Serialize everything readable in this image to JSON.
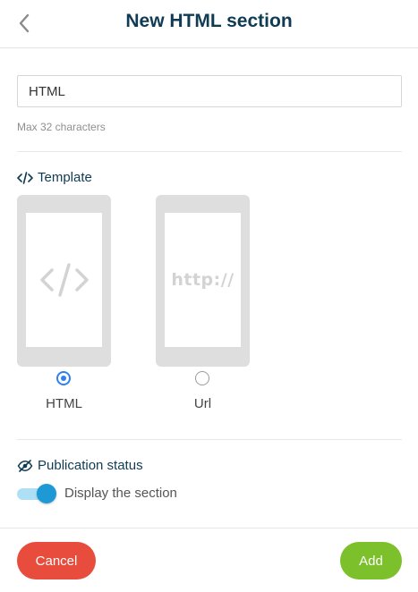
{
  "header": {
    "title": "New HTML section",
    "back_icon": "chevron-left-icon"
  },
  "name_field": {
    "value": "HTML",
    "hint": "Max 32 characters"
  },
  "template_section": {
    "title": "Template",
    "icon": "code-icon",
    "options": [
      {
        "label": "HTML",
        "selected": true,
        "preview_icon": "code-icon"
      },
      {
        "label": "Url",
        "selected": false,
        "preview_text": "http://"
      }
    ]
  },
  "publication_section": {
    "title": "Publication status",
    "icon": "eye-slash-icon",
    "toggle_label": "Display the section",
    "toggle_on": true
  },
  "footer": {
    "cancel_label": "Cancel",
    "add_label": "Add"
  },
  "colors": {
    "title": "#0f3b54",
    "accent_blue": "#1d9ad6",
    "radio_blue": "#2f80ed",
    "cancel_red": "#e74c3c",
    "add_green": "#7cc02b"
  }
}
